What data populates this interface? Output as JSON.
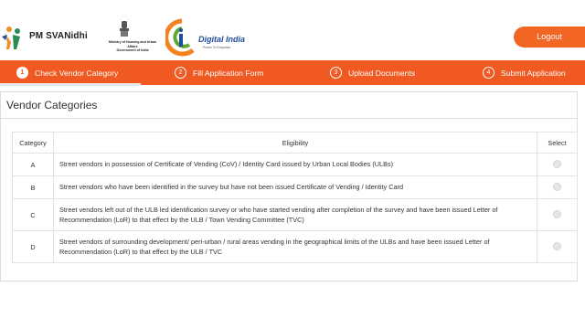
{
  "header": {
    "brand_name": "PM SVANidhi",
    "ministry_line1": "Ministry of Housing and Urban Affairs",
    "ministry_line2": "Government of India",
    "digital_india_title": "Digital India",
    "digital_india_tagline": "Power To Empower",
    "logout_label": "Logout"
  },
  "steps": [
    {
      "number": "1",
      "label": "Check Vendor Category",
      "active": true
    },
    {
      "number": "2",
      "label": "Fill Application Form",
      "active": false
    },
    {
      "number": "3",
      "label": "Upload Documents",
      "active": false
    },
    {
      "number": "4",
      "label": "Submit Application",
      "active": false
    }
  ],
  "panel": {
    "title": "Vendor Categories",
    "columns": {
      "category": "Category",
      "eligibility": "Eligibility",
      "select": "Select"
    },
    "rows": [
      {
        "category": "A",
        "eligibility": "Street vendors in possession of Certificate of Vending (CoV) / Identity Card issued by Urban Local Bodies (ULBs)"
      },
      {
        "category": "B",
        "eligibility": "Street vendors who have been identified in the survey but have not been issued Certificate of Vending / Identity Card"
      },
      {
        "category": "C",
        "eligibility": "Street vendors left out of the ULB led identification survey or who have started vending after completion of the survey and have been issued Letter of Recommendation (LoR) to that effect by the ULB / Town Vending Committee (TVC)"
      },
      {
        "category": "D",
        "eligibility": "Street vendors of surrounding development/ peri-urban / rural areas vending in the geographical limits of the ULBs and have been issued Letter of Recommendation (LoR) to that effect by the ULB / TVC"
      }
    ]
  },
  "colors": {
    "accent": "#f05a22",
    "logout": "#f26522",
    "digital_india_blue": "#1f4e9e"
  },
  "icons": {
    "brand": "pm-svanidhi-logo",
    "emblem": "national-emblem",
    "digital_india": "digital-india-logo",
    "radio": "radio-button"
  }
}
